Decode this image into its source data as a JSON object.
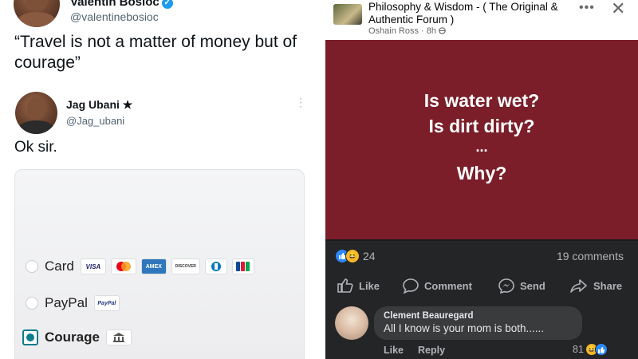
{
  "left": {
    "tweet1": {
      "name": "Valentin Bosioc",
      "handle": "@valentinebosioc",
      "text": "“Travel is not a matter of money but of courage”"
    },
    "tweet2": {
      "name": "Jag Ubani ★",
      "handle": "@Jag_ubani",
      "text": "Ok sir."
    },
    "payment": {
      "options": [
        {
          "label": "Card",
          "logos": [
            "VISA",
            "mastercard",
            "AMEX",
            "DISCOVER",
            "diners",
            "JCB"
          ]
        },
        {
          "label": "PayPal",
          "logos": [
            "PayPal"
          ]
        },
        {
          "label": "Courage",
          "logos": [
            "bank"
          ],
          "selected": true
        }
      ]
    }
  },
  "right": {
    "group_name": "Philosophy & Wisdom  - ( The Original & Authentic Forum )",
    "author": "Oshain Ross",
    "time": "8h",
    "post_lines": [
      "Is water wet?",
      "Is dirt dirty?",
      "...",
      "Why?"
    ],
    "post_bg": "#7b1e2a",
    "reaction_count": "24",
    "comment_count": "19 comments",
    "actions": {
      "like": "Like",
      "comment": "Comment",
      "send": "Send",
      "share": "Share"
    },
    "comment": {
      "name": "Clement Beauregard",
      "text": "All I know is your mom is both......",
      "like": "Like",
      "reply": "Reply",
      "reactions": "81"
    }
  }
}
